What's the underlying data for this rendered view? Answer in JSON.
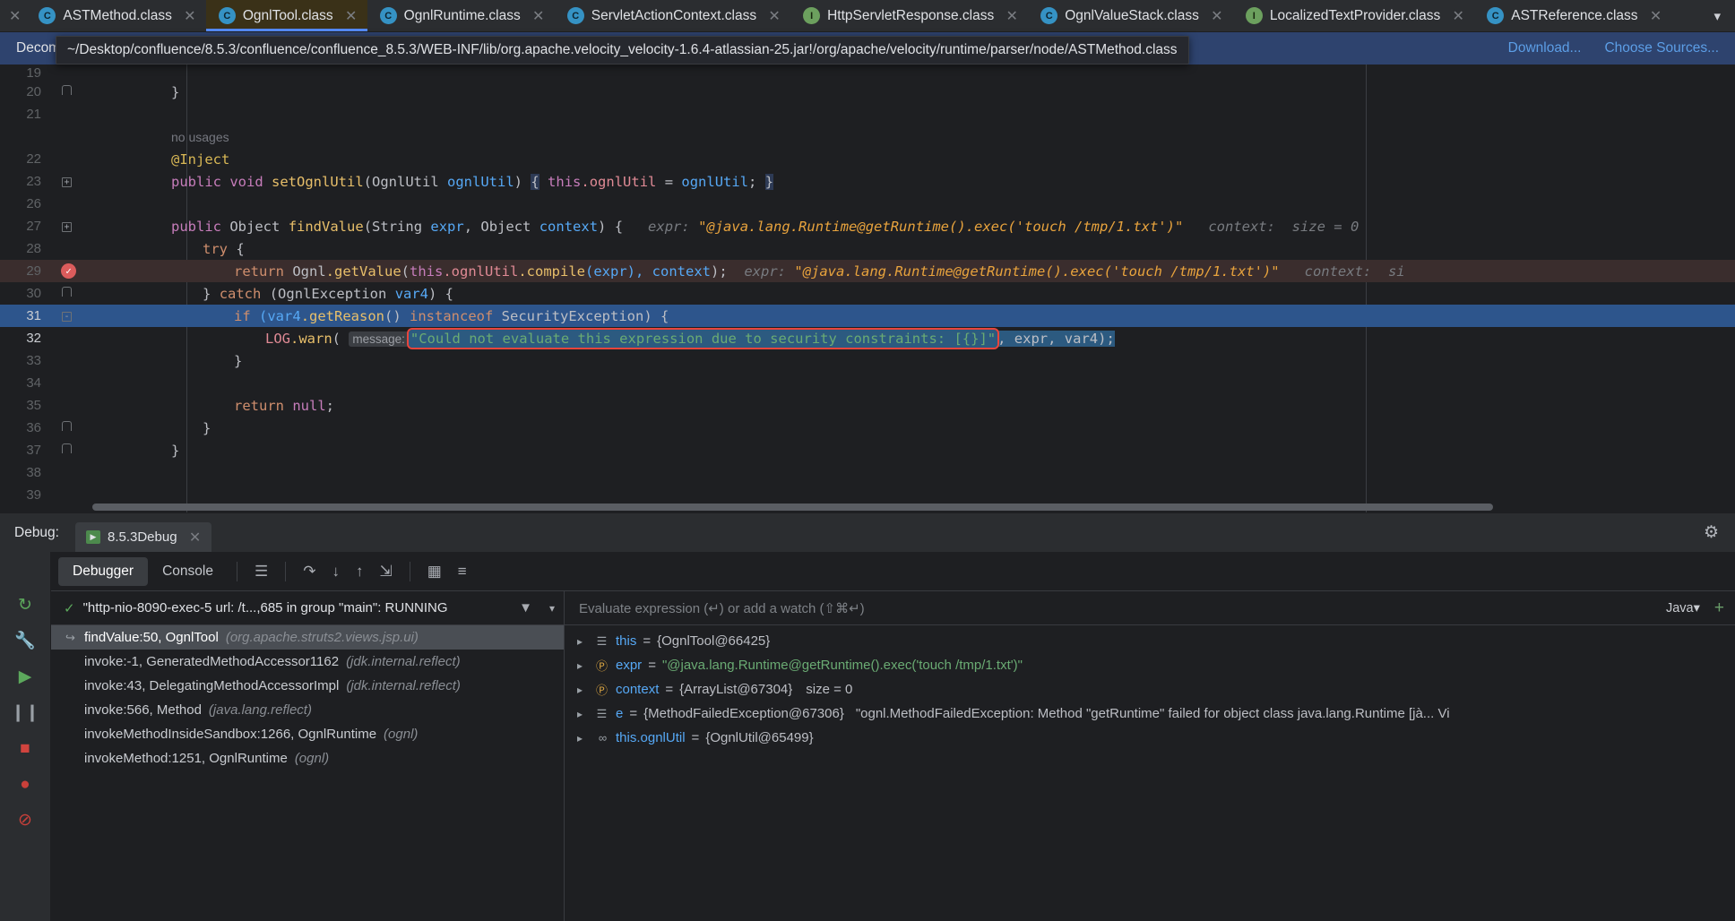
{
  "tabs": [
    {
      "label": "ASTMethod.class",
      "icon": "class-icon",
      "kind": "c",
      "active": false
    },
    {
      "label": "OgnlTool.class",
      "icon": "class-icon",
      "kind": "c",
      "active": true
    },
    {
      "label": "OgnlRuntime.class",
      "icon": "class-icon",
      "kind": "c",
      "active": false
    },
    {
      "label": "ServletActionContext.class",
      "icon": "class-icon",
      "kind": "c",
      "active": false
    },
    {
      "label": "HttpServletResponse.class",
      "icon": "interface-icon",
      "kind": "i",
      "active": false
    },
    {
      "label": "OgnlValueStack.class",
      "icon": "class-icon",
      "kind": "c",
      "active": false
    },
    {
      "label": "LocalizedTextProvider.class",
      "icon": "interface-icon",
      "kind": "i",
      "active": false
    },
    {
      "label": "ASTReference.class",
      "icon": "class-icon",
      "kind": "c",
      "active": false
    }
  ],
  "notice": {
    "text": "Decompiled .class file, bytecode version: 52.0 (Java 8)",
    "download_label": "Download...",
    "choose_sources_label": "Choose Sources..."
  },
  "tooltip": {
    "path": "~/Desktop/confluence/8.5.3/confluence/confluence_8.5.3/WEB-INF/lib/org.apache.velocity_velocity-1.6.4-atlassian-25.jar!/org/apache/velocity/runtime/parser/node/ASTMethod.class"
  },
  "editor": {
    "lines": [
      {
        "n": "19",
        "fold": "none",
        "indent": 0
      },
      {
        "n": "20",
        "fold": "arm",
        "text": "    }"
      },
      {
        "n": "21",
        "fold": "none",
        "text": ""
      },
      {
        "n": "",
        "fold": "none",
        "usage": "no usages"
      },
      {
        "n": "22",
        "fold": "none",
        "text": "    @Inject"
      },
      {
        "n": "23",
        "fold": "box",
        "text": "    public void setOgnlUtil(OgnlUtil ognlUtil) { this.ognlUtil = ognlUtil; }"
      },
      {
        "n": "26",
        "fold": "none",
        "text": ""
      },
      {
        "n": "27",
        "fold": "box",
        "text": "    public Object findValue(String expr, Object context) {"
      },
      {
        "n": "28",
        "fold": "none",
        "text": "        try {"
      },
      {
        "n": "29",
        "fold": "none",
        "text": "            return Ognl.getValue(this.ognlUtil.compile(expr), context);"
      },
      {
        "n": "30",
        "fold": "arm",
        "text": "        } catch (OgnlException var4) {"
      },
      {
        "n": "31",
        "fold": "box",
        "text": "            if (var4.getReason() instanceof SecurityException) {"
      },
      {
        "n": "32",
        "fold": "none",
        "text": "                LOG.warn( message: \"Could not evaluate this expression due to security constraints: [{}]\", expr, var4);"
      },
      {
        "n": "33",
        "fold": "none",
        "text": "            }"
      },
      {
        "n": "34",
        "fold": "none",
        "text": ""
      },
      {
        "n": "35",
        "fold": "none",
        "text": "            return null;"
      },
      {
        "n": "36",
        "fold": "arm",
        "text": "        }"
      },
      {
        "n": "37",
        "fold": "arm",
        "text": "    }"
      },
      {
        "n": "38",
        "fold": "none",
        "text": ""
      },
      {
        "n": "39",
        "fold": "none",
        "text": ""
      }
    ],
    "code": {
      "l20_brace": "}",
      "l21_usages": "no usages",
      "l22_annotation": "@Inject",
      "l23_public": "public",
      "l23_void": "void",
      "l23_method": "setOgnlUtil",
      "l23_open": "(",
      "l23_ptype": "OgnlUtil",
      "l23_pname": " ognlUtil",
      "l23_close": ")",
      "l23_lbrace": "{",
      "l23_this": "this",
      "l23_dot_field": ".ognlUtil",
      "l23_assign": " = ",
      "l23_val": "ognlUtil",
      "l23_semi": ";",
      "l23_rbrace": "}",
      "l27_public": "public",
      "l27_object": "Object",
      "l27_method": "findValue",
      "l27_p1type": "String",
      "l27_p1name": "expr",
      "l27_comma": ", ",
      "l27_p2type": "Object",
      "l27_p2name": "context",
      "l27_tail": ") {",
      "l27_hint_expr_label": "expr:",
      "l27_hint_expr_value": "\"@java.lang.Runtime@getRuntime().exec('touch /tmp/1.txt')\"",
      "l27_hint_ctx_label": "context:",
      "l27_hint_ctx_value": "size = 0",
      "l28_try": "try",
      "l28_brace": "{",
      "l29_return": "return",
      "l29_ognl": "Ognl",
      "l29_getvalue": ".getValue",
      "l29_paren": "(",
      "l29_this": "this",
      "l29_ognlutil": ".ognlUtil",
      "l29_compile": ".compile",
      "l29_expr": "(expr)",
      "l29_ctx": ", context",
      "l29_end": ");",
      "l29_hint_expr_label": "expr:",
      "l29_hint_expr_value": "\"@java.lang.Runtime@getRuntime().exec('touch /tmp/1.txt')\"",
      "l29_hint_ctx_label": "context:",
      "l29_hint_ctx_value": "si",
      "l30_close": "}",
      "l30_catch": "catch",
      "l30_exc": "(OgnlException ",
      "l30_var": "var4",
      "l30_tail": ") {",
      "l31_if": "if",
      "l31_var": "(var4",
      "l31_getreason": ".getReason",
      "l31_parens": "() ",
      "l31_instanceof": "instanceof",
      "l31_sec": " SecurityException",
      "l31_tail": ") {",
      "l32_log": "LOG",
      "l32_warn": ".warn",
      "l32_paren": "(",
      "l32_param_hint": "message:",
      "l32_string": "\"Could not evaluate this expression due to security constraints: [{}]\"",
      "l32_args": ", expr, var4);",
      "l33_brace": "}",
      "l35_return": "return",
      "l35_null": "null",
      "l35_semi": ";",
      "l36_brace": "}",
      "l37_brace": "}"
    }
  },
  "debug_panel": {
    "title": "Debug:",
    "session_tab": "8.5.3Debug",
    "tabs": [
      {
        "label": "Debugger",
        "active": true
      },
      {
        "label": "Console",
        "active": false
      }
    ],
    "thread": {
      "status": "\"http-nio-8090-exec-5 url: /t...,685 in group \"main\": RUNNING"
    },
    "frames": [
      {
        "method": "findValue:50, OgnlTool",
        "pkg": "(org.apache.struts2.views.jsp.ui)",
        "selected": true,
        "has_arrow": true
      },
      {
        "method": "invoke:-1, GeneratedMethodAccessor1162",
        "pkg": "(jdk.internal.reflect)",
        "selected": false,
        "has_arrow": false
      },
      {
        "method": "invoke:43, DelegatingMethodAccessorImpl",
        "pkg": "(jdk.internal.reflect)",
        "selected": false,
        "has_arrow": false
      },
      {
        "method": "invoke:566, Method",
        "pkg": "(java.lang.reflect)",
        "selected": false,
        "has_arrow": false
      },
      {
        "method": "invokeMethodInsideSandbox:1266, OgnlRuntime",
        "pkg": "(ognl)",
        "selected": false,
        "has_arrow": false
      },
      {
        "method": "invokeMethod:1251, OgnlRuntime",
        "pkg": "(ognl)",
        "selected": false,
        "has_arrow": false
      }
    ],
    "evaluate": {
      "placeholder": "Evaluate expression (↵) or add a watch (⇧⌘↵)",
      "language": "Java"
    },
    "variables": [
      {
        "icon": "object-icon",
        "icon_kind": "obj",
        "name": "this",
        "eq": " = ",
        "value": "{OgnlTool@66425}",
        "extra": "",
        "value_is_string": false
      },
      {
        "icon": "parameter-icon",
        "icon_kind": "param",
        "name": "expr",
        "eq": " = ",
        "value": "\"@java.lang.Runtime@getRuntime().exec('touch /tmp/1.txt')\"",
        "extra": "",
        "value_is_string": true
      },
      {
        "icon": "parameter-icon",
        "icon_kind": "param",
        "name": "context",
        "eq": " = ",
        "value": "{ArrayList@67304}",
        "extra": "size = 0",
        "value_is_string": false
      },
      {
        "icon": "object-icon",
        "icon_kind": "obj",
        "name": "e",
        "eq": " = ",
        "value": "{MethodFailedException@67306}",
        "extra": "\"ognl.MethodFailedException: Method \"getRuntime\" failed for object class java.lang.Runtime [jà... Vi",
        "value_is_string": false
      },
      {
        "icon": "reference-icon",
        "icon_kind": "link",
        "name": "this.ognlUtil",
        "eq": " = ",
        "value": "{OgnlUtil@65499}",
        "extra": "",
        "value_is_string": false
      }
    ]
  },
  "colors": {
    "accent": "#548af7",
    "breakpoint": "#db5c5c",
    "annotation_box": "#e8453c",
    "selection": "#2d558c",
    "exec_line": "#3a2d2d"
  }
}
